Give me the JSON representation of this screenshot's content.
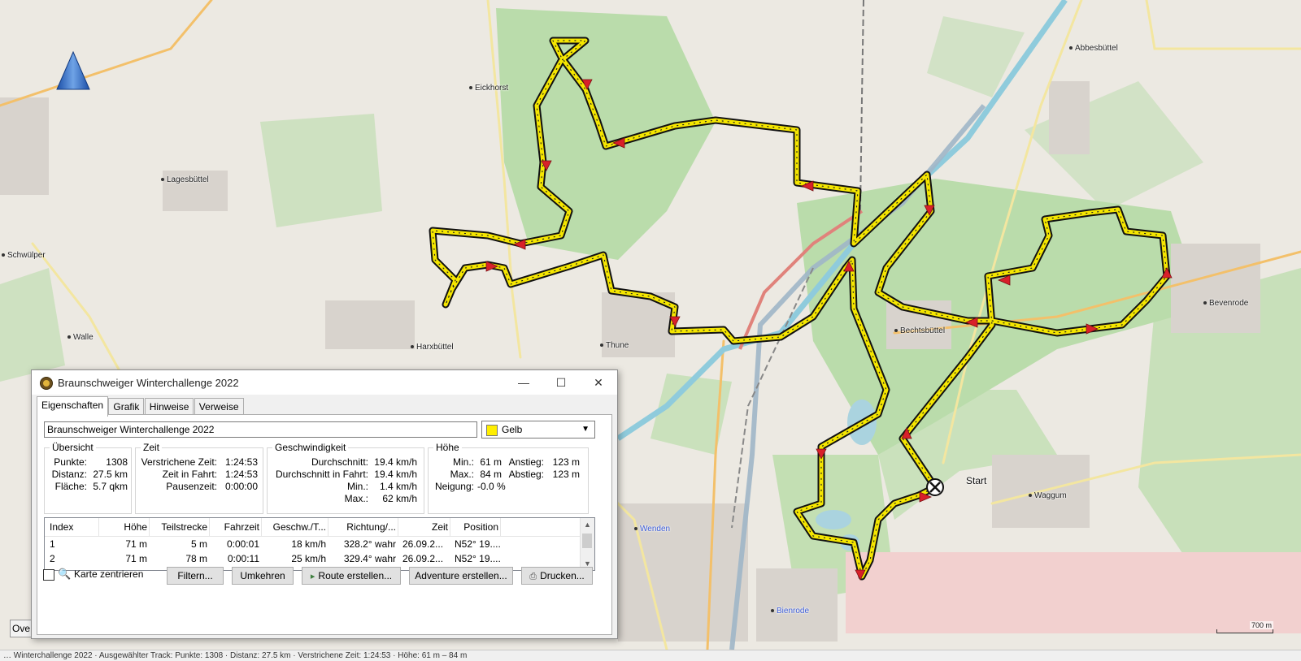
{
  "map": {
    "places": [
      {
        "name": "Abbesbüttel",
        "style": "dot"
      },
      {
        "name": "Eickhorst",
        "style": "dot"
      },
      {
        "name": "Lagesbüttel",
        "style": "dot"
      },
      {
        "name": "Schwülper",
        "style": "dot"
      },
      {
        "name": "Walle",
        "style": "dot"
      },
      {
        "name": "Harxbüttel",
        "style": "dot"
      },
      {
        "name": "Thune",
        "style": "dot"
      },
      {
        "name": "Bechtsbüttel",
        "style": "dot"
      },
      {
        "name": "Bevenrode",
        "style": "dot"
      },
      {
        "name": "Waggum",
        "style": "dot"
      },
      {
        "name": "Wenden",
        "style": "blue"
      },
      {
        "name": "Bienrode",
        "style": "blue"
      }
    ],
    "start_label": "Start",
    "scale_label": "700 m",
    "overview_label": "Ove",
    "track_color": "#f5e600",
    "forest_color": "#b5dba5",
    "road_color": "#f3c06a",
    "water_color": "#aad3df"
  },
  "statusbar": {
    "text": "… Winterchallenge 2022 · Ausgewählter Track: Punkte: 1308 · Distanz: 27.5 km · Verstrichene Zeit: 1:24:53 · Höhe: 61 m – 84 m"
  },
  "dialog": {
    "title": "Braunschweiger Winterchallenge 2022",
    "window_buttons": {
      "minimize": "—",
      "maximize": "☐",
      "close": "✕"
    },
    "tabs": [
      "Eigenschaften",
      "Grafik",
      "Hinweise",
      "Verweise"
    ],
    "name_value": "Braunschweiger Winterchallenge 2022",
    "color": {
      "label": "Gelb",
      "swatch": "#ffee00"
    },
    "overview": {
      "title": "Übersicht",
      "rows": [
        {
          "k": "Punkte:",
          "v": "1308"
        },
        {
          "k": "Distanz:",
          "v": "27.5 km"
        },
        {
          "k": "Fläche:",
          "v": "5.7 qkm"
        }
      ]
    },
    "time": {
      "title": "Zeit",
      "rows": [
        {
          "k": "Verstrichene Zeit:",
          "v": "1:24:53"
        },
        {
          "k": "Zeit in Fahrt:",
          "v": "1:24:53"
        },
        {
          "k": "Pausenzeit:",
          "v": "0:00:00"
        }
      ]
    },
    "speed": {
      "title": "Geschwindigkeit",
      "rows": [
        {
          "k": "Durchschnitt:",
          "v": "19.4 km/h"
        },
        {
          "k": "Durchschnitt in Fahrt:",
          "v": "19.4 km/h"
        },
        {
          "k": "Min.:",
          "v": "1.4 km/h"
        },
        {
          "k": "Max.:",
          "v": "62 km/h"
        }
      ]
    },
    "height": {
      "title": "Höhe",
      "rows": [
        {
          "k": "Min.:",
          "v": "61 m",
          "k2": "Anstieg:",
          "v2": "123 m"
        },
        {
          "k": "Max.:",
          "v": "84 m",
          "k2": "Abstieg:",
          "v2": "123 m"
        },
        {
          "k": "Neigung:",
          "v": "-0.0 %",
          "k2": "",
          "v2": ""
        }
      ]
    },
    "table": {
      "columns": [
        "Index",
        "Höhe",
        "Teilstrecke",
        "Fahrzeit",
        "Geschw./T...",
        "Richtung/...",
        "Zeit",
        "Position"
      ],
      "rows": [
        [
          "1",
          "71 m",
          "5 m",
          "0:00:01",
          "18 km/h",
          "328.2° wahr",
          "26.09.2...",
          "N52° 19...."
        ],
        [
          "2",
          "71 m",
          "78 m",
          "0:00:11",
          "25 km/h",
          "329.4° wahr",
          "26.09.2...",
          "N52° 19...."
        ]
      ]
    },
    "center_map_label": "Karte zentrieren",
    "buttons": {
      "filter": "Filtern...",
      "reverse": "Umkehren",
      "create_route": "Route erstellen...",
      "create_adventure": "Adventure erstellen...",
      "print": "Drucken..."
    }
  }
}
